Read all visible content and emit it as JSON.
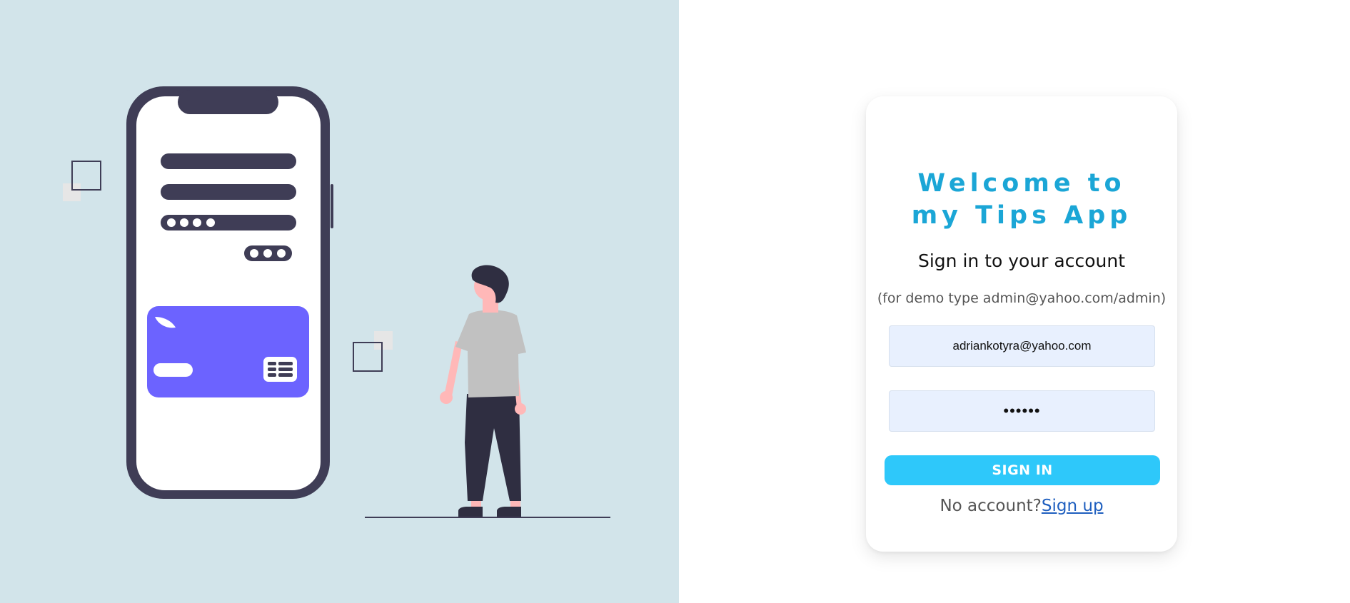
{
  "login": {
    "welcome_line1": "Welcome to",
    "welcome_line2": "my Tips App",
    "subtitle": "Sign in to your account",
    "demo_hint": "(for demo type admin@yahoo.com/admin)",
    "email_value": "adriankotyra@yahoo.com",
    "password_value": "admin1",
    "signin_label": "SIGN IN",
    "no_account_text": "No account?",
    "signup_label": "Sign up"
  },
  "colors": {
    "left_background": "#d2e4ea",
    "accent": "#1ba6d6",
    "button": "#2ec8fa",
    "phone_frame": "#3f3d56",
    "credit_card": "#6c63ff"
  },
  "illustration": {
    "name": "mobile-login-illustration"
  }
}
